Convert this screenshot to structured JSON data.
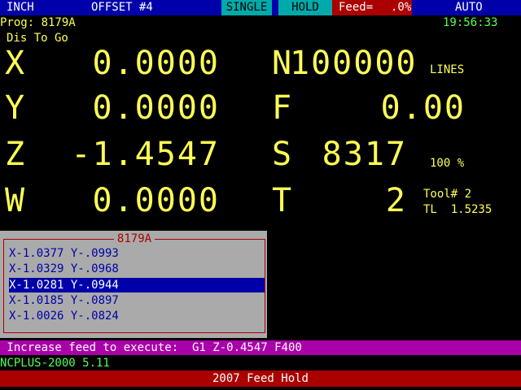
{
  "status_bar": {
    "units": "INCH",
    "offset": "OFFSET #4",
    "mode_single": "SINGLE",
    "mode_hold": "HOLD",
    "feed_label": "Feed=",
    "feed_value": ".0%",
    "run_mode": "AUTO"
  },
  "header": {
    "program": "Prog: 8179A",
    "clock": "19:56:33",
    "dist_label": "Dis To Go"
  },
  "axes": [
    {
      "name": "X",
      "value": "0.0000"
    },
    {
      "name": "Y",
      "value": "0.0000"
    },
    {
      "name": "Z",
      "value": "-1.4547"
    },
    {
      "name": "W",
      "value": "0.0000"
    }
  ],
  "codes": {
    "n_label": "N",
    "n_value": "100000",
    "lines_label": "LINES",
    "f_label": "F",
    "f_value": "0.00",
    "s_label": "S",
    "s_value": "8317",
    "spindle_pct": "100 %",
    "t_label": "T",
    "t_value": "2",
    "tool_num": "Tool# 2",
    "tool_len": "TL  1.5235"
  },
  "program_panel": {
    "title": "8179A",
    "lines": [
      "X-1.0377 Y-.0993",
      "X-1.0329 Y-.0968",
      "X-1.0281 Y-.0944",
      "X-1.0185 Y-.0897",
      "X-1.0026 Y-.0824"
    ],
    "selected_index": 2
  },
  "message": " Increase feed to execute:  G1 Z-0.4547 F400",
  "version": "NCPLUS-2000 5.11",
  "alarm": "2007 Feed Hold",
  "colors": {
    "top_bar": "#0000aa",
    "accent_cyan": "#00aaaa",
    "alarm_red": "#aa0000",
    "text_yellow": "#ffff55",
    "text_green": "#55ff55",
    "message_magenta": "#aa00aa"
  }
}
